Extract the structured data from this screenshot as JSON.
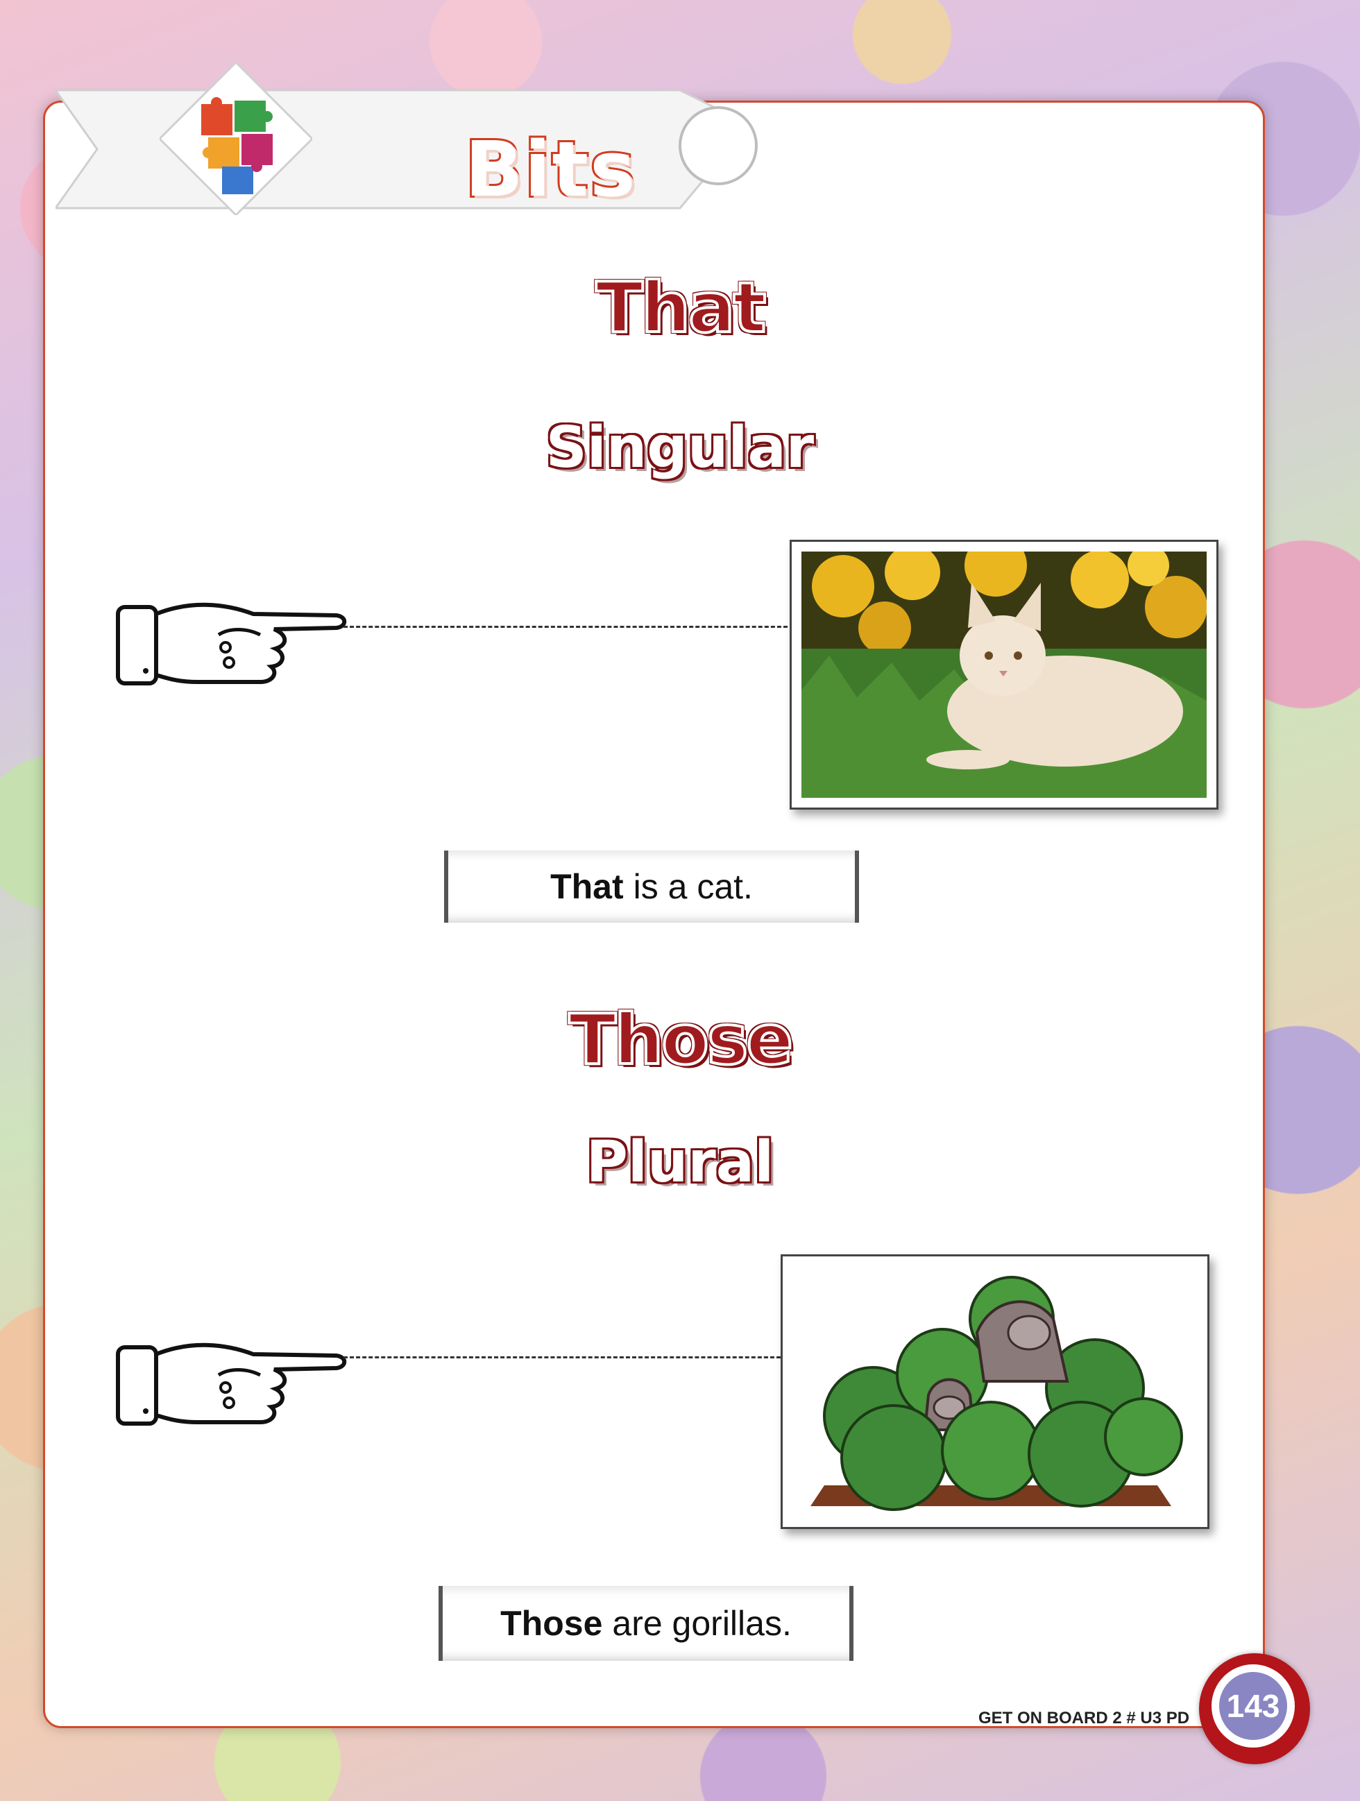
{
  "banner": {
    "title": "Bits",
    "icon": "puzzle-icon"
  },
  "section_that": {
    "heading": "That",
    "subheading": "Singular",
    "image": "cat-photo",
    "sentence_bold": "That",
    "sentence_rest": "is a cat."
  },
  "section_those": {
    "heading": "Those",
    "subheading": "Plural",
    "image": "gorillas-illustration",
    "sentence_bold": "Those",
    "sentence_rest": "are gorillas."
  },
  "footer": {
    "book": "GET ON BOARD 2 # U3 PD",
    "page_number": "143"
  },
  "colors": {
    "accent_red": "#a01b1e",
    "banner_red": "#d23b1e",
    "badge_purple": "#8a86c4"
  }
}
